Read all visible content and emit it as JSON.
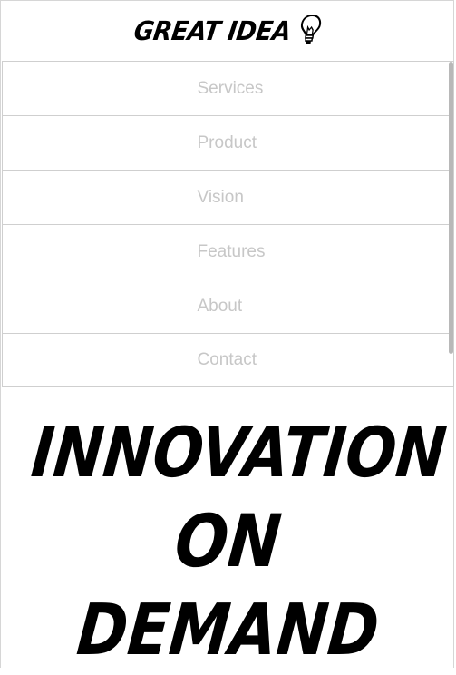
{
  "header": {
    "logo_text": "GREAT IDEA",
    "logo_icon": "lightbulb-icon"
  },
  "nav": {
    "items": [
      {
        "label": "Services"
      },
      {
        "label": "Product"
      },
      {
        "label": "Vision"
      },
      {
        "label": "Features"
      },
      {
        "label": "About"
      },
      {
        "label": "Contact"
      }
    ]
  },
  "hero": {
    "line1": "INNOVATION",
    "line2": "ON",
    "line3": "DEMAND"
  },
  "colors": {
    "text": "#000000",
    "nav_text": "#c7c7c7",
    "border": "#cfcfcf",
    "background": "#ffffff"
  }
}
